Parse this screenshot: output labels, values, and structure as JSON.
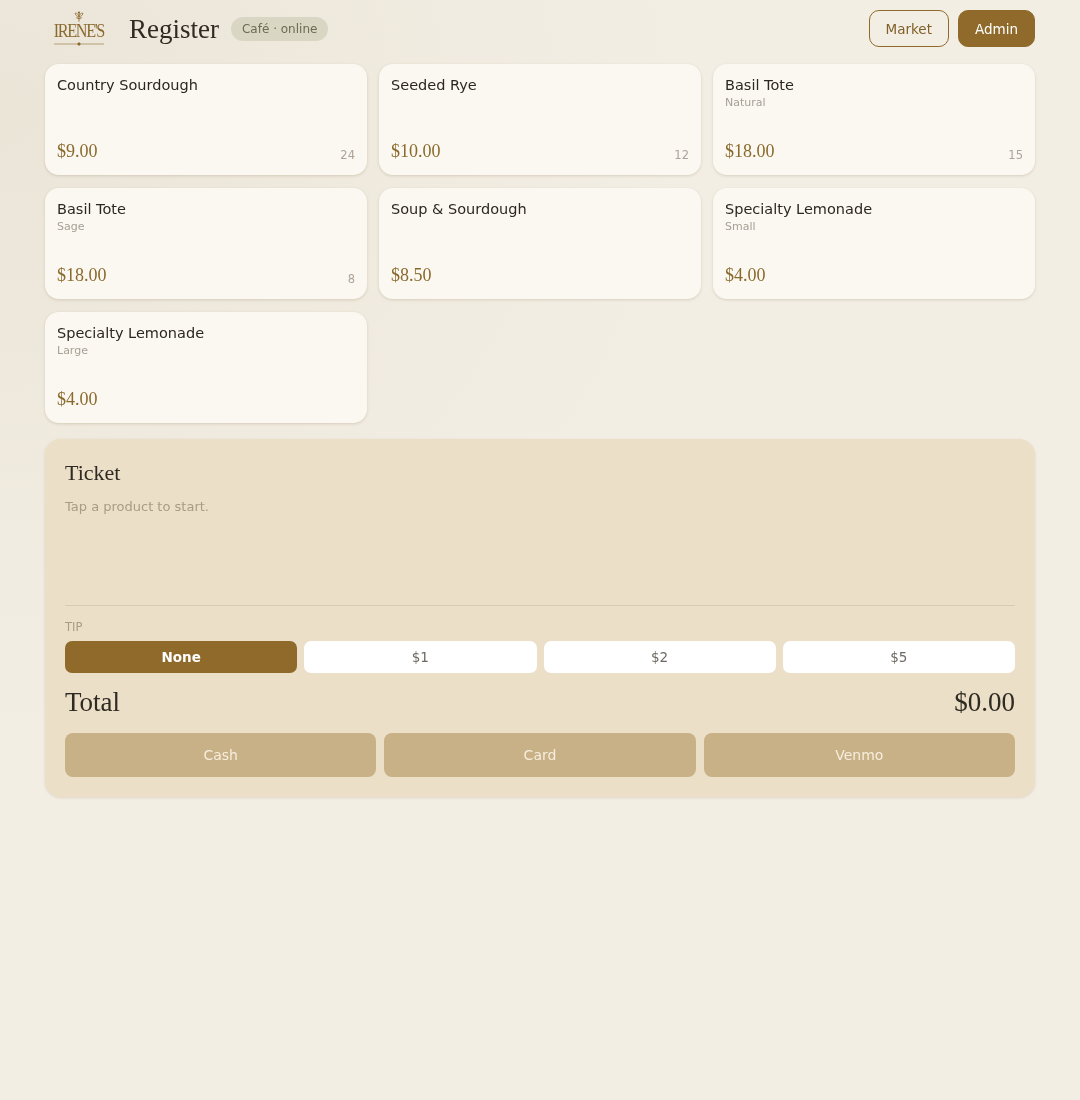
{
  "header": {
    "logo_text": "IRENE'S",
    "title": "Register",
    "badge": "Café · online",
    "buttons": [
      {
        "label": "Market",
        "kind": "outline"
      },
      {
        "label": "Admin",
        "kind": "filled"
      }
    ]
  },
  "products": [
    {
      "name": "Country Sourdough",
      "price": "$9.00",
      "stock": "24"
    },
    {
      "name": "Seeded Rye",
      "price": "$10.00",
      "stock": "12"
    },
    {
      "name": "Basil Tote",
      "variant": "Natural",
      "price": "$18.00",
      "stock": "15"
    },
    {
      "name": "Basil Tote",
      "variant": "Sage",
      "price": "$18.00",
      "stock": "8"
    },
    {
      "name": "Soup & Sourdough",
      "price": "$8.50"
    },
    {
      "name": "Specialty Lemonade",
      "variant": "Small",
      "price": "$4.00"
    },
    {
      "name": "Specialty Lemonade",
      "variant": "Large",
      "price": "$4.00"
    }
  ],
  "ticket": {
    "title": "Ticket",
    "empty_hint": "Tap a product to start.",
    "tip_label": "TIP",
    "tips": [
      {
        "label": "None",
        "selected": true
      },
      {
        "label": "$1",
        "selected": false
      },
      {
        "label": "$2",
        "selected": false
      },
      {
        "label": "$5",
        "selected": false
      }
    ],
    "total_label": "Total",
    "total": "$0.00",
    "payments": [
      {
        "label": "Cash",
        "disabled": true
      },
      {
        "label": "Card",
        "disabled": true
      },
      {
        "label": "Venmo",
        "disabled": true
      }
    ]
  }
}
